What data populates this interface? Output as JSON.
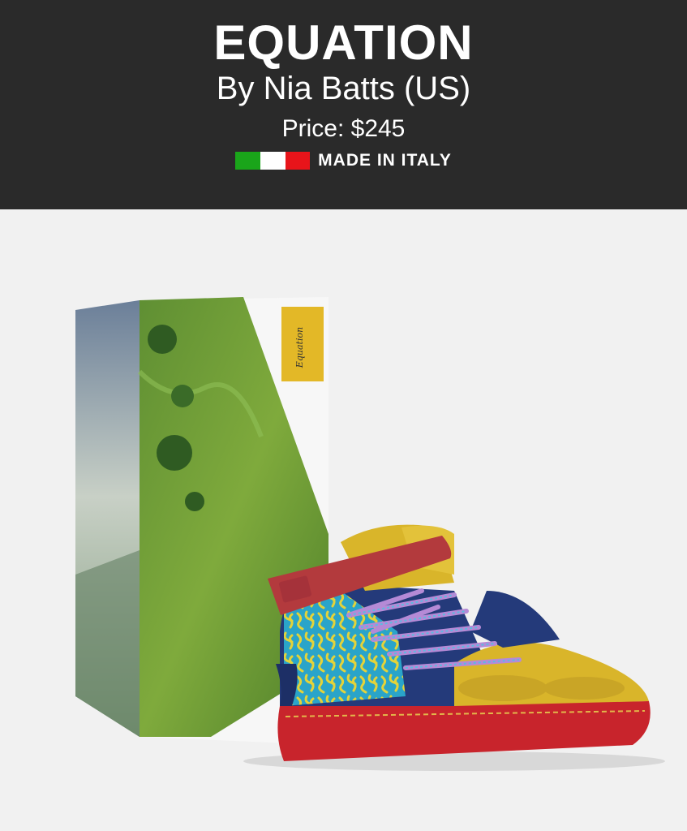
{
  "product": {
    "name": "EQUATION",
    "designer": "By Nia Batts (US)",
    "price": "Price: $245",
    "origin": "MADE IN ITALY",
    "box_label": "Equation"
  },
  "flag_colors": [
    "#1aa51a",
    "#ffffff",
    "#e8141a"
  ],
  "colors": {
    "header_bg": "#2a2a2a",
    "page_bg": "#f1f1f1",
    "sole": "#c8242c",
    "strap": "#b33a3d",
    "navy": "#243a7a",
    "yellow": "#d9b52a",
    "cyan": "#2aa4c9"
  }
}
